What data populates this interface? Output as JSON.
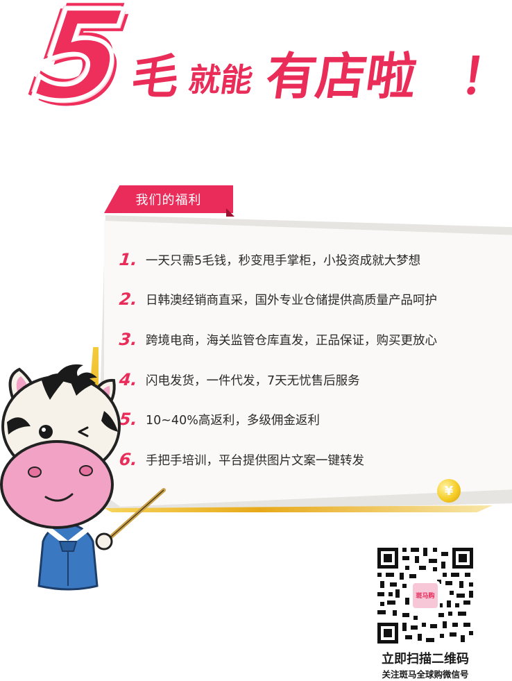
{
  "headline": {
    "number": "5",
    "mao": "毛",
    "jiu_neng": "就能",
    "you_dian_la": "有店啦",
    "bang": "！"
  },
  "section": {
    "title": "我们的福利"
  },
  "benefits": [
    {
      "num": "1.",
      "text": "一天只需5毛钱，秒变甩手掌柜，小投资成就大梦想"
    },
    {
      "num": "2.",
      "text": "日韩澳经销商直采，国外专业仓储提供高质量产品呵护"
    },
    {
      "num": "3.",
      "text": "跨境电商，海关监管仓库直发，正品保证，购买更放心"
    },
    {
      "num": "4.",
      "text": "闪电发货，一件代发，7天无忧售后服务"
    },
    {
      "num": "5.",
      "text": "10~40%高返利，多级佣金返利"
    },
    {
      "num": "6.",
      "text": "手把手培训，平台提供图片文案一键转发"
    }
  ],
  "coin": {
    "symbol": "¥"
  },
  "qr": {
    "title": "立即扫描二维码",
    "subtitle": "关注斑马全球购微信号",
    "logo_text": "斑马购"
  },
  "colors": {
    "accent": "#e92c5a",
    "gold": "#f0b928",
    "text": "#2a2a2a",
    "mascot_face": "#f2a2c4",
    "mascot_robe": "#3a79c2"
  }
}
